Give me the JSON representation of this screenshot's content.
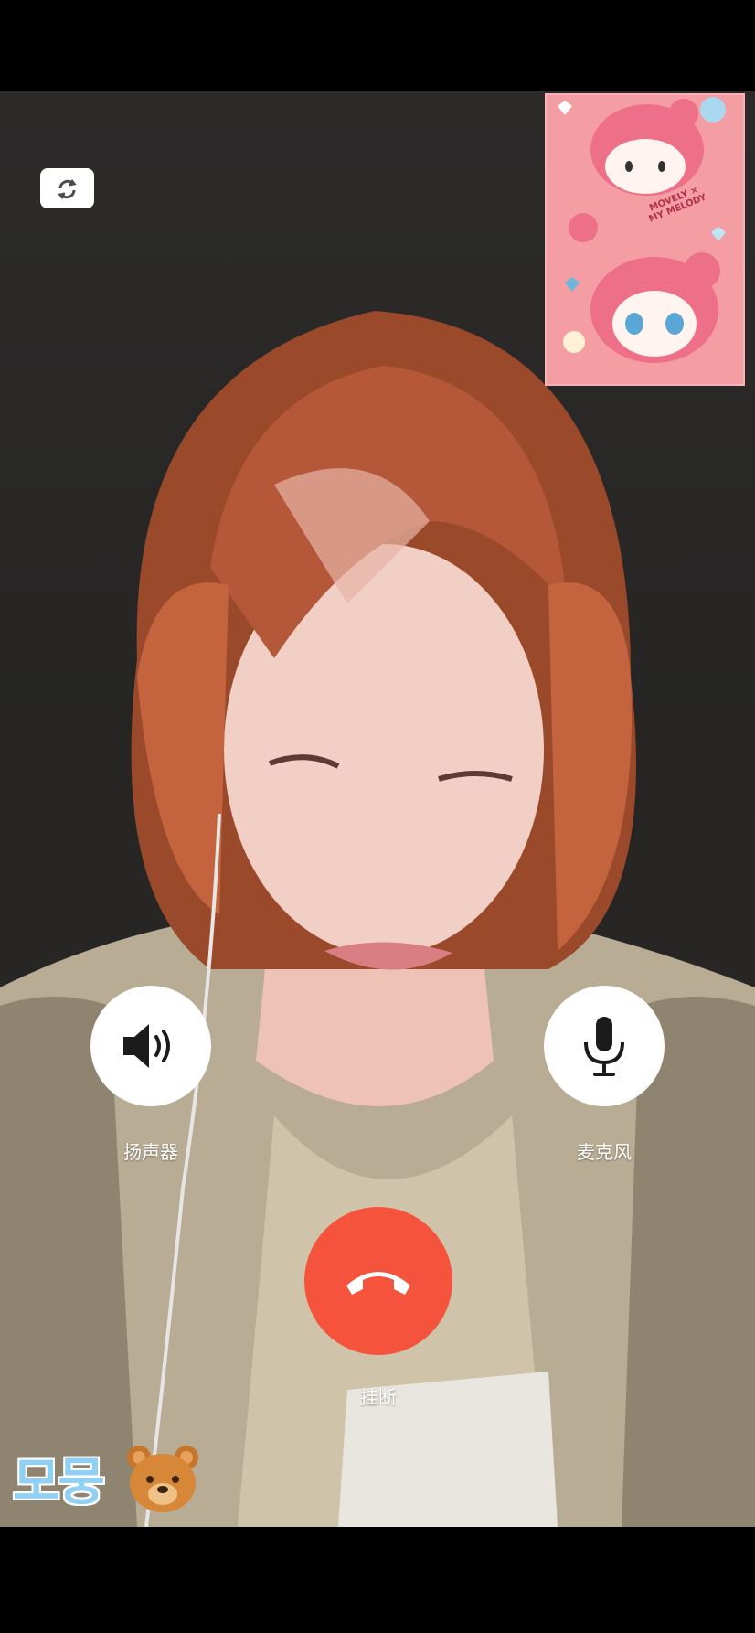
{
  "call": {
    "speaker_label": "扬声器",
    "mic_label": "麦克风",
    "hangup_label": "挂断"
  },
  "pip": {
    "sticker_text_line1": "MOVELY ×",
    "sticker_text_line2": "MY MELODY"
  },
  "overlay": {
    "watermark_text": "모뭉"
  },
  "icons": {
    "camera_switch": "camera-switch-icon",
    "speaker": "speaker-icon",
    "microphone": "microphone-icon",
    "hangup": "phone-hangup-icon",
    "bear": "bear-emoji-icon"
  },
  "colors": {
    "hangup": "#f5533b",
    "control_bg": "#ffffff",
    "pip_pink": "#f49da3",
    "watermark": "#8fd0f3"
  }
}
